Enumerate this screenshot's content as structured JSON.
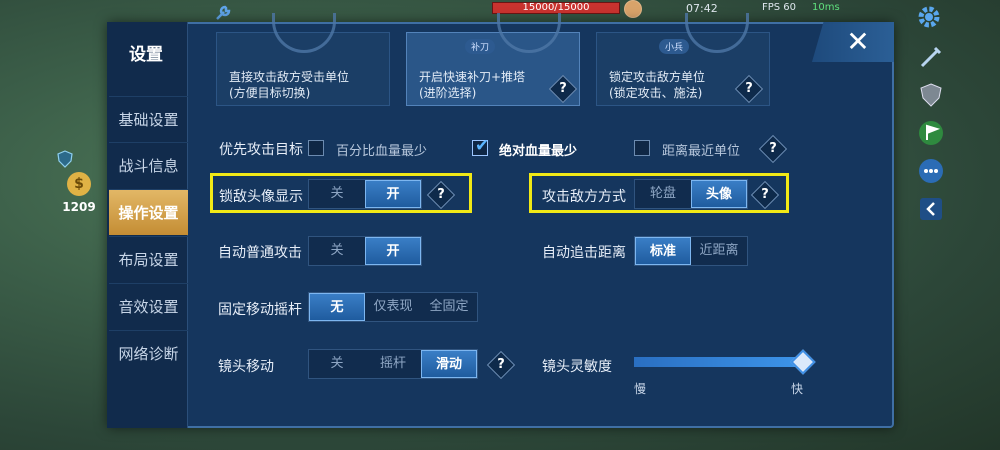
{
  "hud": {
    "hp_text": "15000/15000",
    "clock": "07:42",
    "fps": "FPS 60",
    "net": "10ms",
    "gold": "1209"
  },
  "panel": {
    "title": "设置",
    "close_label": "✕"
  },
  "sidebar": {
    "items": [
      {
        "label": "基础设置",
        "active": false
      },
      {
        "label": "战斗信息",
        "active": false
      },
      {
        "label": "操作设置",
        "active": true
      },
      {
        "label": "布局设置",
        "active": false
      },
      {
        "label": "音效设置",
        "active": false
      },
      {
        "label": "网络诊断",
        "active": false
      }
    ]
  },
  "cards": [
    {
      "text1": "直接攻击敌方受击单位",
      "text2": "(方便目标切换)",
      "highlight": false
    },
    {
      "badge": "补刀",
      "text1": "开启快速补刀+推塔",
      "text2": "(进阶选择)",
      "highlight": true,
      "help": "?"
    },
    {
      "badge": "小兵",
      "text1": "锁定攻击敌方单位",
      "text2": "(锁定攻击、施法)",
      "highlight": false,
      "help": "?"
    }
  ],
  "priority": {
    "label": "优先攻击目标",
    "options": [
      {
        "label": "百分比血量最少",
        "checked": false
      },
      {
        "label": "绝对血量最少",
        "checked": true
      },
      {
        "label": "距离最近单位",
        "checked": false
      }
    ],
    "help": "?"
  },
  "lock_avatar": {
    "label": "锁敌头像显示",
    "options": [
      "关",
      "开"
    ],
    "selected": "开",
    "help": "?"
  },
  "attack_mode": {
    "label": "攻击敌方方式",
    "options": [
      "轮盘",
      "头像"
    ],
    "selected": "头像",
    "help": "?"
  },
  "auto_attack": {
    "label": "自动普通攻击",
    "options": [
      "关",
      "开"
    ],
    "selected": "开"
  },
  "auto_chase": {
    "label": "自动追击距离",
    "options": [
      "标准",
      "近距离"
    ],
    "selected": "标准"
  },
  "joystick": {
    "label": "固定移动摇杆",
    "options": [
      "无",
      "仅表现",
      "全固定"
    ],
    "selected": "无"
  },
  "camera_move": {
    "label": "镜头移动",
    "options": [
      "关",
      "摇杆",
      "滑动"
    ],
    "selected": "滑动",
    "help": "?"
  },
  "camera_sensitivity": {
    "label": "镜头灵敏度",
    "min_label": "慢",
    "max_label": "快",
    "value_fraction": 1.0
  },
  "colors": {
    "panel_bg": "#15365e",
    "active_tab": "#d6a44e",
    "selected_segment": "#2f6fb4",
    "highlight_box": "#f1e916"
  }
}
